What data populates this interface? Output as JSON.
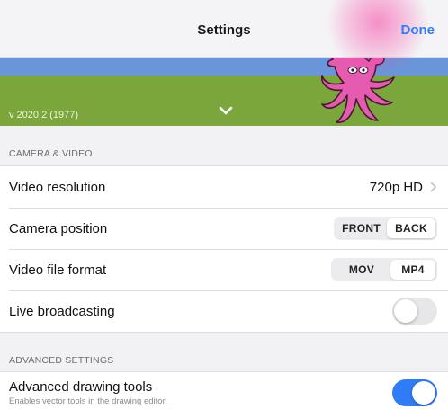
{
  "navbar": {
    "title": "Settings",
    "done_label": "Done"
  },
  "banner": {
    "version": "v 2020.2 (1977)",
    "expand_icon": "chevron-down-icon",
    "mascot_icon": "octopus-icon"
  },
  "camera_section": {
    "header": "CAMERA & VIDEO",
    "video_resolution": {
      "label": "Video resolution",
      "value": "720p HD"
    },
    "camera_position": {
      "label": "Camera position",
      "options": [
        "FRONT",
        "BACK"
      ],
      "selected": "BACK"
    },
    "video_file_format": {
      "label": "Video file format",
      "options": [
        "MOV",
        "MP4"
      ],
      "selected": "MP4"
    },
    "live_broadcasting": {
      "label": "Live broadcasting",
      "enabled": false
    }
  },
  "advanced_section": {
    "header": "ADVANCED SETTINGS",
    "advanced_drawing_tools": {
      "label": "Advanced drawing tools",
      "sublabel": "Enables vector tools in the drawing editor.",
      "enabled": true
    }
  },
  "colors": {
    "accent": "#2f7cf6",
    "grass": "#7aa63b",
    "sky": "#6a95d8",
    "mascot": "#e55bb0"
  }
}
